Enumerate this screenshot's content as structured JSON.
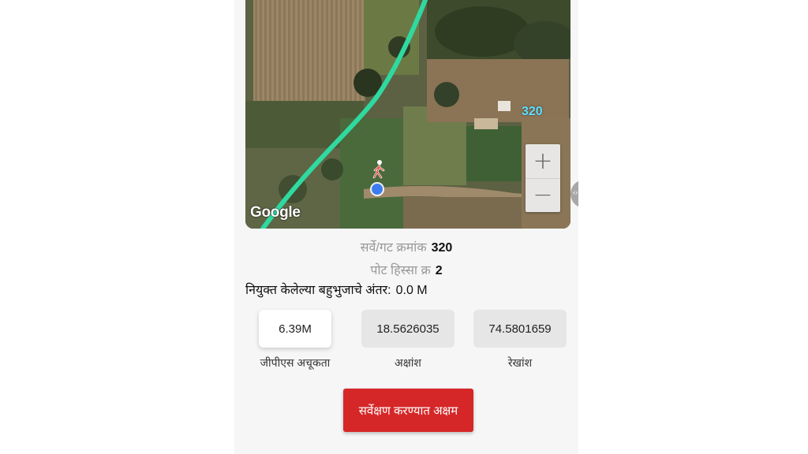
{
  "map": {
    "logo_text": "Google",
    "plot_number_label": "320",
    "zoom_in_label": "+",
    "zoom_out_label": "−"
  },
  "survey": {
    "survey_no_label": "सर्वे/गट क्रमांक",
    "survey_no_value": "320",
    "sub_division_label": "पोट हिस्सा क्र",
    "sub_division_value": "2",
    "distance_label": "नियुक्त केलेल्या बहुभुजाचे अंतर:",
    "distance_value": "0.0 M"
  },
  "stats": {
    "gps_accuracy_value": "6.39M",
    "gps_accuracy_label": "जीपीएस अचूकता",
    "latitude_value": "18.5626035",
    "latitude_label": "अक्षांश",
    "longitude_value": "74.5801659",
    "longitude_label": "रेखांश"
  },
  "action": {
    "button_label": "सर्वेक्षण करण्यात अक्षम",
    "button_color": "#d62728"
  },
  "colors": {
    "path_line": "#2fd9a0",
    "location_dot": "#3d7cf0",
    "plot_label": "#5fe0ff"
  },
  "icons": {
    "walker": "pedestrian-icon",
    "location": "location-dot-icon"
  }
}
